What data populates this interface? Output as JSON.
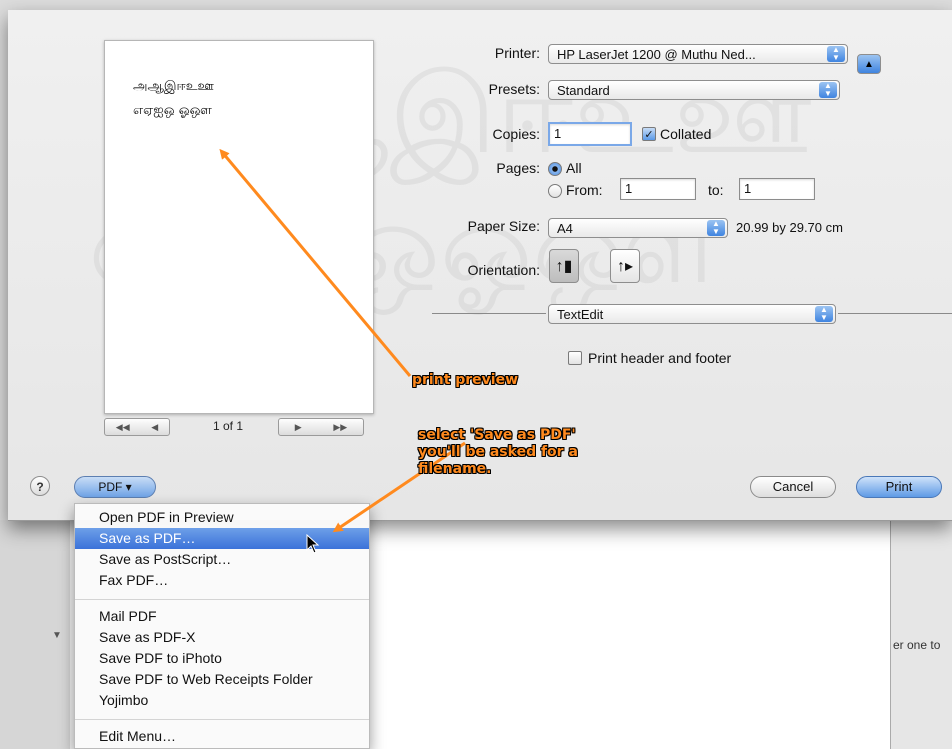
{
  "preview": {
    "line1": "அஆஇஈஉஊ",
    "line2": "எஏஐஒ ஓஔ",
    "page_count": "1 of 1",
    "ghost1": "அஆஇஈஉஊ",
    "ghost2": "எஏஐஒஓஔ"
  },
  "printer": {
    "label": "Printer:",
    "value": "HP LaserJet 1200 @ Muthu Ned..."
  },
  "presets": {
    "label": "Presets:",
    "value": "Standard"
  },
  "copies": {
    "label": "Copies:",
    "value": "1",
    "collated_label": "Collated",
    "collated": true
  },
  "pages": {
    "label": "Pages:",
    "all_label": "All",
    "from_label": "From:",
    "from_value": "1",
    "to_label": "to:",
    "to_value": "1"
  },
  "paper_size": {
    "label": "Paper Size:",
    "value": "A4",
    "dimensions": "20.99 by 29.70 cm"
  },
  "orientation": {
    "label": "Orientation:"
  },
  "app_section": {
    "value": "TextEdit"
  },
  "header_footer": {
    "label": "Print header and footer",
    "checked": false
  },
  "buttons": {
    "help": "?",
    "pdf": "PDF ▾",
    "cancel": "Cancel",
    "print": "Print"
  },
  "pdf_menu": {
    "items": [
      "Open PDF in Preview",
      "Save as PDF…",
      "Save as PostScript…",
      "Fax PDF…",
      "Mail PDF",
      "Save as PDF-X",
      "Save PDF to iPhoto",
      "Save PDF to Web Receipts Folder",
      "Yojimbo",
      "Edit Menu…"
    ],
    "highlighted_index": 1
  },
  "annotations": {
    "preview_note": "print preview",
    "save_note": "select 'Save as PDF'\nyou'll be asked for a\nfilename."
  },
  "background": {
    "side_text": "er one to"
  },
  "colors": {
    "annotation": "#ff8a1e",
    "highlight": "#3b72d9",
    "accent_blue": "#5e9ae6"
  }
}
